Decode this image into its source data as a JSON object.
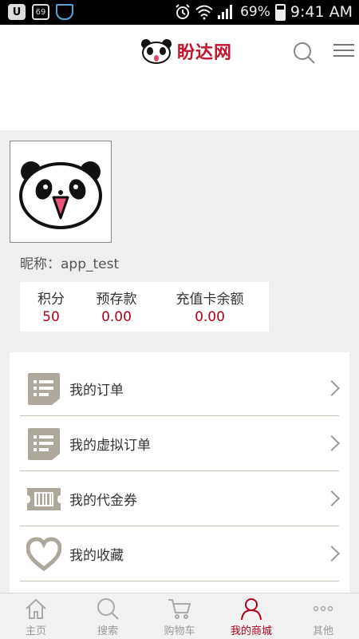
{
  "status_bar": {
    "left_icons": [
      "u-app-icon",
      "notification-69-icon",
      "shield-icon"
    ],
    "notification_count": "69",
    "battery_percent": "69%",
    "time": "9:41 AM"
  },
  "header": {
    "logo_text": "盼达网"
  },
  "profile": {
    "nickname": "昵称：app_test"
  },
  "stats": [
    {
      "label": "积分",
      "value": "50"
    },
    {
      "label": "预存款",
      "value": "0.00"
    },
    {
      "label": "充值卡余额",
      "value": "0.00"
    }
  ],
  "menu": [
    {
      "label": "我的订单",
      "icon": "order-list-icon"
    },
    {
      "label": "我的虚拟订单",
      "icon": "virtual-order-icon"
    },
    {
      "label": "我的代金券",
      "icon": "voucher-icon"
    },
    {
      "label": "我的收藏",
      "icon": "heart-icon"
    }
  ],
  "tabs": [
    {
      "label": "主页",
      "icon": "home-icon"
    },
    {
      "label": "搜索",
      "icon": "search-icon"
    },
    {
      "label": "购物车",
      "icon": "cart-icon"
    },
    {
      "label": "我的商城",
      "icon": "user-icon",
      "active": true
    },
    {
      "label": "其他",
      "icon": "more-icon"
    }
  ],
  "colors": {
    "brand_red": "#c0162c",
    "value_red": "#b3001b",
    "icon_gray": "#ada79c"
  }
}
